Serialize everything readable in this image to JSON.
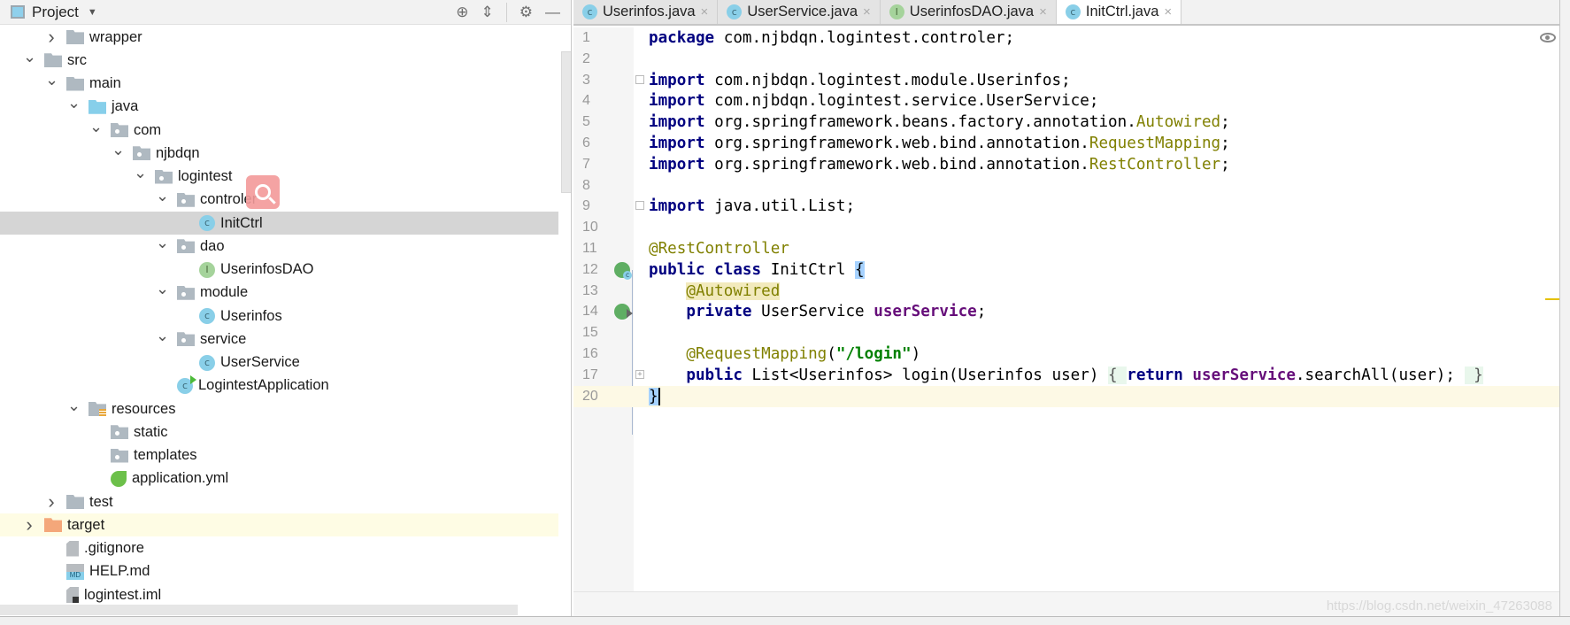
{
  "project_panel": {
    "title": "Project",
    "tree": [
      {
        "label": "wrapper",
        "level": 1,
        "arrow": "collapsed",
        "icon": "folder"
      },
      {
        "label": "src",
        "level": 0,
        "arrow": "expanded",
        "icon": "folder"
      },
      {
        "label": "main",
        "level": 1,
        "arrow": "expanded",
        "icon": "folder"
      },
      {
        "label": "java",
        "level": 2,
        "arrow": "expanded",
        "icon": "folder-src"
      },
      {
        "label": "com",
        "level": 3,
        "arrow": "expanded",
        "icon": "pkg"
      },
      {
        "label": "njbdqn",
        "level": 4,
        "arrow": "expanded",
        "icon": "pkg"
      },
      {
        "label": "logintest",
        "level": 5,
        "arrow": "expanded",
        "icon": "pkg"
      },
      {
        "label": "controler",
        "level": 6,
        "arrow": "expanded",
        "icon": "pkg"
      },
      {
        "label": "InitCtrl",
        "level": 7,
        "arrow": "none",
        "icon": "cls",
        "selected": true
      },
      {
        "label": "dao",
        "level": 6,
        "arrow": "expanded",
        "icon": "pkg"
      },
      {
        "label": "UserinfosDAO",
        "level": 7,
        "arrow": "none",
        "icon": "intf"
      },
      {
        "label": "module",
        "level": 6,
        "arrow": "expanded",
        "icon": "pkg"
      },
      {
        "label": "Userinfos",
        "level": 7,
        "arrow": "none",
        "icon": "cls"
      },
      {
        "label": "service",
        "level": 6,
        "arrow": "expanded",
        "icon": "pkg"
      },
      {
        "label": "UserService",
        "level": 7,
        "arrow": "none",
        "icon": "cls"
      },
      {
        "label": "LogintestApplication",
        "level": 6,
        "arrow": "none",
        "icon": "app"
      },
      {
        "label": "resources",
        "level": 2,
        "arrow": "expanded",
        "icon": "res"
      },
      {
        "label": "static",
        "level": 3,
        "arrow": "none",
        "icon": "pkg"
      },
      {
        "label": "templates",
        "level": 3,
        "arrow": "none",
        "icon": "pkg"
      },
      {
        "label": "application.yml",
        "level": 3,
        "arrow": "none",
        "icon": "spring"
      },
      {
        "label": "test",
        "level": 1,
        "arrow": "collapsed",
        "icon": "folder"
      },
      {
        "label": "target",
        "level": 0,
        "arrow": "collapsed",
        "icon": "folder-target",
        "highlighted": true
      },
      {
        "label": ".gitignore",
        "level": 1,
        "arrow": "none",
        "icon": "file"
      },
      {
        "label": "HELP.md",
        "level": 1,
        "arrow": "none",
        "icon": "md"
      },
      {
        "label": "logintest.iml",
        "level": 1,
        "arrow": "none",
        "icon": "iml"
      }
    ]
  },
  "tabs": [
    {
      "label": "Userinfos.java",
      "icon": "c"
    },
    {
      "label": "UserService.java",
      "icon": "c"
    },
    {
      "label": "UserinfosDAO.java",
      "icon": "I"
    },
    {
      "label": "InitCtrl.java",
      "icon": "c",
      "active": true
    }
  ],
  "editor": {
    "lines": [
      {
        "n": "1",
        "tokens": [
          {
            "t": "package",
            "c": "kw"
          },
          {
            "t": " com.njbdqn.logintest.controler;"
          }
        ]
      },
      {
        "n": "2",
        "tokens": []
      },
      {
        "n": "3",
        "fold": "-",
        "tokens": [
          {
            "t": "import",
            "c": "kw"
          },
          {
            "t": " com.njbdqn.logintest.module.Userinfos;"
          }
        ]
      },
      {
        "n": "4",
        "tokens": [
          {
            "t": "import",
            "c": "kw"
          },
          {
            "t": " com.njbdqn.logintest.service.UserService;"
          }
        ]
      },
      {
        "n": "5",
        "tokens": [
          {
            "t": "import",
            "c": "kw"
          },
          {
            "t": " org.springframework.beans.factory.annotation."
          },
          {
            "t": "Autowired",
            "c": "ann"
          },
          {
            "t": ";"
          }
        ]
      },
      {
        "n": "6",
        "tokens": [
          {
            "t": "import",
            "c": "kw"
          },
          {
            "t": " org.springframework.web.bind.annotation."
          },
          {
            "t": "RequestMapping",
            "c": "ann"
          },
          {
            "t": ";"
          }
        ]
      },
      {
        "n": "7",
        "tokens": [
          {
            "t": "import",
            "c": "kw"
          },
          {
            "t": " org.springframework.web.bind.annotation."
          },
          {
            "t": "RestController",
            "c": "ann"
          },
          {
            "t": ";"
          }
        ]
      },
      {
        "n": "8",
        "tokens": []
      },
      {
        "n": "9",
        "fold": "-",
        "tokens": [
          {
            "t": "import",
            "c": "kw"
          },
          {
            "t": " java.util.List;"
          }
        ]
      },
      {
        "n": "10",
        "tokens": []
      },
      {
        "n": "11",
        "tokens": [
          {
            "t": "@RestController",
            "c": "ann"
          }
        ]
      },
      {
        "n": "12",
        "gutter": "bean-class",
        "tokens": [
          {
            "t": "public class",
            "c": "kw"
          },
          {
            "t": " InitCtrl "
          },
          {
            "t": "{",
            "c": "brace-hl"
          }
        ]
      },
      {
        "n": "13",
        "tokens": [
          {
            "t": "    "
          },
          {
            "t": "@Autowired",
            "c": "ann-hl"
          }
        ]
      },
      {
        "n": "14",
        "gutter": "bean-autowired",
        "tokens": [
          {
            "t": "    "
          },
          {
            "t": "private",
            "c": "kw"
          },
          {
            "t": " UserService "
          },
          {
            "t": "userService",
            "c": "fld"
          },
          {
            "t": ";"
          }
        ]
      },
      {
        "n": "15",
        "tokens": []
      },
      {
        "n": "16",
        "tokens": [
          {
            "t": "    "
          },
          {
            "t": "@RequestMapping",
            "c": "ann"
          },
          {
            "t": "("
          },
          {
            "t": "\"/login\"",
            "c": "str"
          },
          {
            "t": ")"
          }
        ]
      },
      {
        "n": "17",
        "fold": "+",
        "tokens": [
          {
            "t": "    "
          },
          {
            "t": "public",
            "c": "kw"
          },
          {
            "t": " List<Userinfos> login(Userinfos user) "
          },
          {
            "t": "{ ",
            "c": "fold-bg"
          },
          {
            "t": "return",
            "c": "kw"
          },
          {
            "t": " "
          },
          {
            "t": "userService",
            "c": "fld"
          },
          {
            "t": ".searchAll(user); "
          },
          {
            "t": " }",
            "c": "fold-bg"
          }
        ]
      },
      {
        "n": "20",
        "current": true,
        "tokens": [
          {
            "t": "}",
            "c": "brace-hl caret-cursor"
          }
        ]
      }
    ]
  },
  "watermark": "https://blog.csdn.net/weixin_47263088",
  "colors": {
    "keyword": "#000080",
    "annotation": "#808000",
    "string": "#008000",
    "field": "#660e7a",
    "selection": "#d5d5d5",
    "current_line": "#fdf9e5"
  }
}
